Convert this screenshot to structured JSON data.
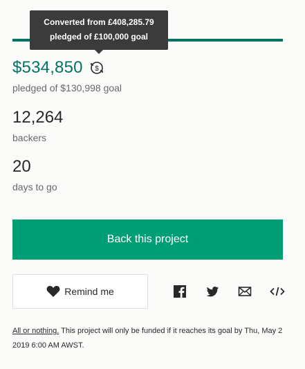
{
  "tooltip": {
    "line1": "Converted from £408,285.79",
    "line2": "pledged of £100,000 goal"
  },
  "progress": {
    "percent": 100,
    "color": "#037362"
  },
  "pledged": {
    "amount": "$534,850",
    "goal_text": "pledged of $130,998 goal",
    "icon": "currency-convert-icon"
  },
  "stats": {
    "backers_value": "12,264",
    "backers_label": "backers",
    "days_value": "20",
    "days_label": "days to go"
  },
  "actions": {
    "back_label": "Back this project",
    "back_color": "#009e74",
    "remind_label": "Remind me",
    "remind_icon": "heart-icon"
  },
  "share": {
    "icons": [
      "facebook-icon",
      "twitter-icon",
      "email-icon",
      "embed-icon"
    ]
  },
  "footer": {
    "link_text": "All or nothing.",
    "text": " This project will only be funded if it reaches its goal by Thu, May 2 2019 6:00 AM AWST."
  }
}
